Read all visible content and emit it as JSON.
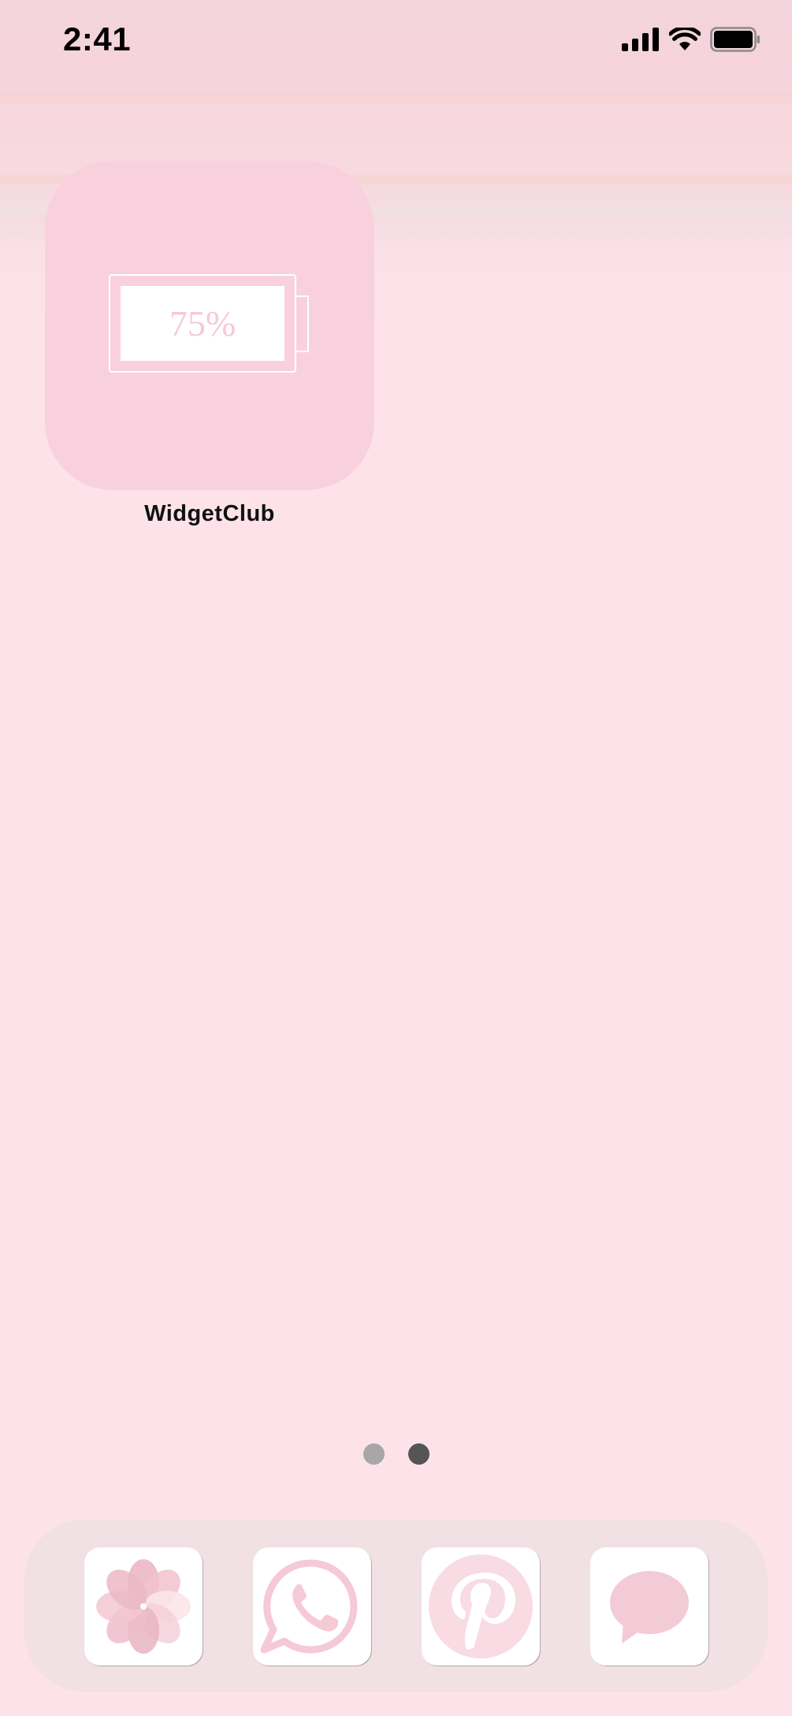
{
  "status_bar": {
    "time": "2:41",
    "icons": [
      "cellular-signal-icon",
      "wifi-icon",
      "battery-icon"
    ]
  },
  "widget": {
    "battery_percent_text": "75%",
    "battery_level": 0.75,
    "app_label": "WidgetClub"
  },
  "page_indicator": {
    "pages": 2,
    "current_page": 2
  },
  "dock": {
    "apps": [
      {
        "name": "Photos",
        "icon": "photos-flower-icon"
      },
      {
        "name": "WhatsApp",
        "icon": "whatsapp-icon"
      },
      {
        "name": "Pinterest",
        "icon": "pinterest-icon"
      },
      {
        "name": "Messages",
        "icon": "messages-bubble-icon"
      }
    ]
  },
  "colors": {
    "wallpaper": "#fde3e9",
    "widget_bg": "#f9d1de",
    "icon_pink": "#f6c9d6",
    "dot_inactive": "#a8a6a7",
    "dot_active": "#555555",
    "dock_bg": "#f1e0e4"
  }
}
